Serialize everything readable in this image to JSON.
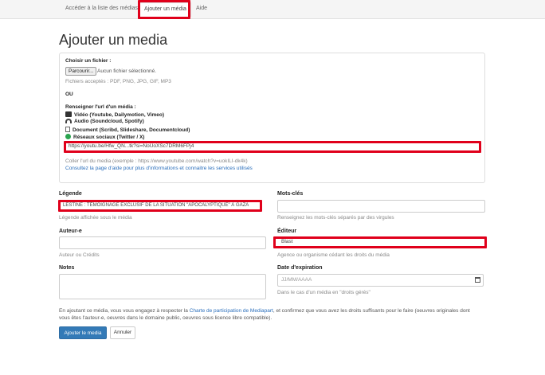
{
  "nav": {
    "tabs": [
      {
        "label": "Accéder à la liste des médias"
      },
      {
        "label": "Ajouter un média"
      },
      {
        "label": "Aide"
      }
    ]
  },
  "page": {
    "title": "Ajouter un media"
  },
  "file_section": {
    "label": "Choisir un fichier :",
    "browse_button": "Parcourir...",
    "no_file": "Aucun fichier sélectionné.",
    "accepted": "Fichiers acceptés : PDF, PNG, JPG, GIF, MP3",
    "or": "OU"
  },
  "url_section": {
    "label": "Renseigner l'url d'un média :",
    "types": [
      {
        "icon": "video-camera-icon",
        "label": "Vidéo (Youtube, Dailymotion, Vimeo)"
      },
      {
        "icon": "headphones-icon",
        "label": "Audio (Soundcloud, Spotify)"
      },
      {
        "icon": "document-icon",
        "label": "Document (Scribd, Slideshare, Documentcloud)"
      },
      {
        "icon": "globe-icon",
        "label": "Réseaux sociaux (Twitter / X)"
      }
    ],
    "url_value": "https://youtu.be/Hfw_QN...tk?si=NoUoXSc7DRM6FPj4",
    "help": "Coller l'url du media (exemple : https://www.youtube.com/watch?v=uokILI-dk4k)",
    "help_link": "Consultez la page d'aide pour plus d'informations et connaitre les services utilisés"
  },
  "form": {
    "legende": {
      "label": "Légende",
      "value": "LESTINE : TÉMOIGNAGE EXCLUSIF DE LA SITUATION \"APOCALYPTIQUE\" À GAZA",
      "help": "Légende affichée sous le média"
    },
    "mots_cles": {
      "label": "Mots-clés",
      "value": "",
      "help": "Renseignez les mots-clés séparés par des virgules"
    },
    "auteur": {
      "label": "Auteur-e",
      "value": "",
      "help": "Auteur ou Crédits"
    },
    "editeur": {
      "label": "Éditeur",
      "value": "Blast",
      "help": "Agence ou organisme cédant les droits du média"
    },
    "notes": {
      "label": "Notes",
      "value": ""
    },
    "expiration": {
      "label": "Date d'expiration",
      "placeholder": "JJ/MM/AAAA",
      "help": "Dans le cas d'un média en \"droits gérés\""
    }
  },
  "footer": {
    "line1_before": "En ajoutant ce média, vous vous engagez à respecter la ",
    "line1_link": "Charte de participation de Mediapart",
    "line1_after": ", et confirmez que vous avez les droits suffisants pour le faire (oeuvres originales dont",
    "line2": "vous êtes l'auteur-e, oeuvres dans le domaine public, oeuvres sous licence libre compatible).",
    "submit": "Ajouter le media",
    "cancel": "Annuler"
  },
  "colors": {
    "highlight": "#e0001b",
    "primary": "#337ab7",
    "link": "#2a6ebb"
  }
}
